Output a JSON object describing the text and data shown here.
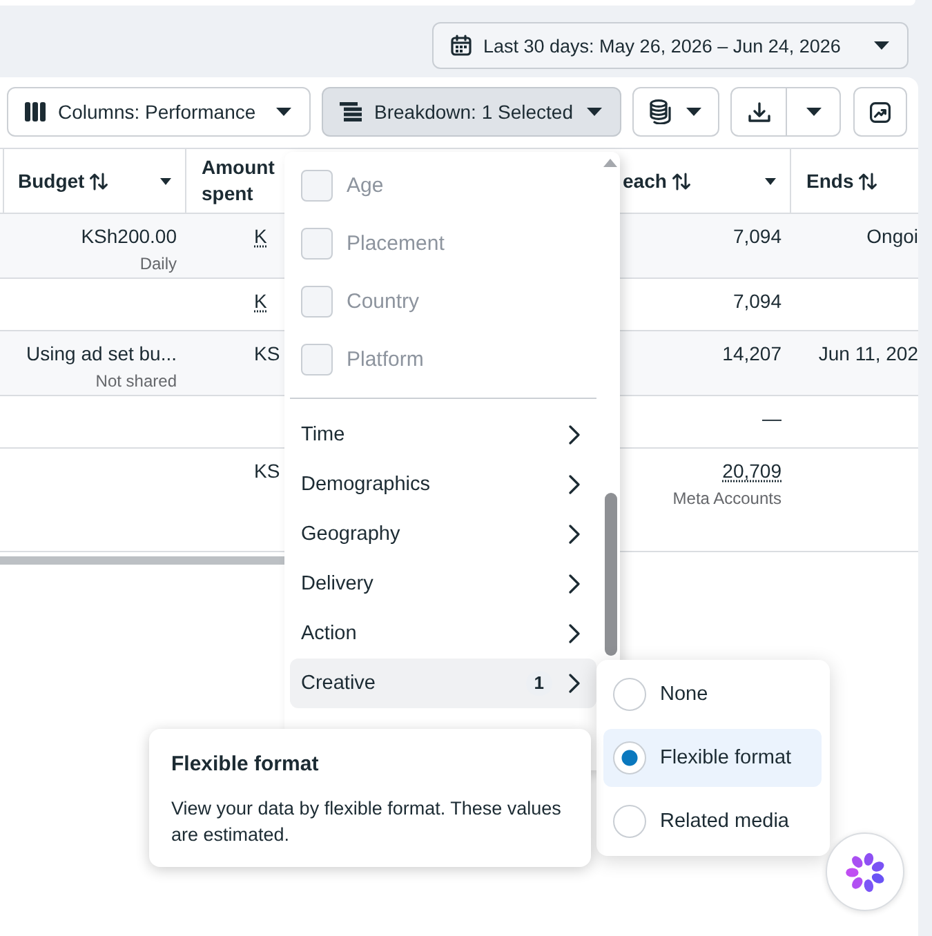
{
  "date_range": {
    "label": "Last 30 days: May 26, 2026 – Jun 24, 2026"
  },
  "toolbar": {
    "columns": {
      "label": "Columns: Performance",
      "expanded": false
    },
    "breakdown": {
      "label": "Breakdown: 1 Selected",
      "expanded": true
    }
  },
  "table": {
    "columns": [
      {
        "label": "Budget",
        "sortable": true,
        "has_menu": true
      },
      {
        "label": "Amount spent"
      },
      {
        "label": "each",
        "sortable": true,
        "has_menu": true
      },
      {
        "label": "Ends",
        "sortable": true,
        "has_menu": false
      }
    ],
    "rows": [
      {
        "kind": "item",
        "budget": {
          "text": "KSh200.00",
          "note": "Daily"
        },
        "amount_spent": {
          "text": "K",
          "dotted": true
        },
        "reach": {
          "text": "7,094",
          "dotted": false
        },
        "ends": {
          "text": "Ongoi"
        }
      },
      {
        "kind": "breakdown",
        "amount_spent": {
          "text": "K",
          "dotted": true
        },
        "reach": {
          "text": "7,094",
          "dotted": false
        }
      },
      {
        "kind": "item",
        "budget": {
          "text": "Using ad set bu...",
          "note": "Not shared"
        },
        "amount_spent": {
          "text": "KS",
          "dotted": false
        },
        "reach": {
          "text": "14,207",
          "dotted": false
        },
        "ends": {
          "text": "Jun 11, 202"
        }
      },
      {
        "kind": "breakdown",
        "reach": {
          "text": "—",
          "dotted": false
        }
      },
      {
        "kind": "total",
        "amount_spent": {
          "text": "KS",
          "dotted": false
        },
        "reach": {
          "text": "20,709",
          "note": "Meta Accounts",
          "dotted": true
        }
      }
    ]
  },
  "breakdown_menu": {
    "checkbox_items": [
      {
        "label": "Age",
        "checked": false,
        "disabled": true
      },
      {
        "label": "Placement",
        "checked": false,
        "disabled": true
      },
      {
        "label": "Country",
        "checked": false,
        "disabled": true
      },
      {
        "label": "Platform",
        "checked": false,
        "disabled": true
      }
    ],
    "categories": [
      {
        "label": "Time",
        "expanded": false
      },
      {
        "label": "Demographics",
        "expanded": false
      },
      {
        "label": "Geography",
        "expanded": false
      },
      {
        "label": "Delivery",
        "expanded": false
      },
      {
        "label": "Action",
        "expanded": false
      },
      {
        "label": "Creative",
        "expanded": true,
        "count": "1"
      }
    ]
  },
  "creative_submenu": {
    "options": [
      {
        "label": "None",
        "selected": false
      },
      {
        "label": "Flexible format",
        "selected": true
      },
      {
        "label": "Related media",
        "selected": false
      }
    ]
  },
  "tooltip": {
    "title": "Flexible format",
    "text": "View your data by flexible format. These values are estimated."
  }
}
